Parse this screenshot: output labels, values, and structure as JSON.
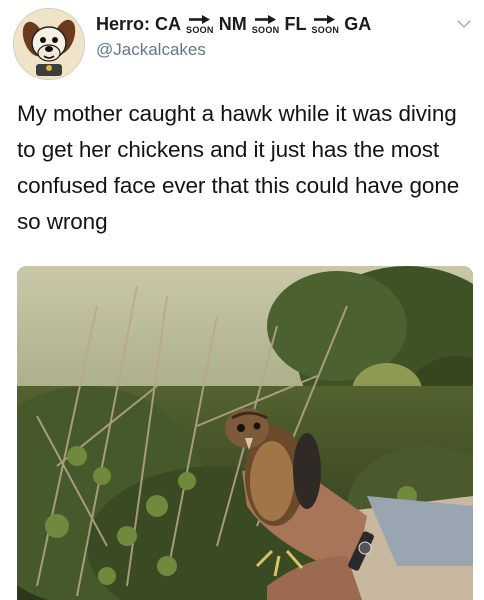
{
  "tweet": {
    "display_name": {
      "prefix": "Herro:",
      "segments": [
        "CA",
        "NM",
        "FL",
        "GA"
      ],
      "arrow_label": "SOON"
    },
    "handle": "@Jackalcakes",
    "text": "My mother caught a hawk while it was diving to get her chickens and it just has the most confused face ever that this could have gone so wrong",
    "menu_icon": "chevron-down-icon",
    "avatar_icon": "cartoon-dog-avatar",
    "photo_subject": "hawk-held-in-hands-photo"
  },
  "colors": {
    "text": "#141414",
    "handle": "#657786",
    "chevron": "#aab8c2"
  }
}
